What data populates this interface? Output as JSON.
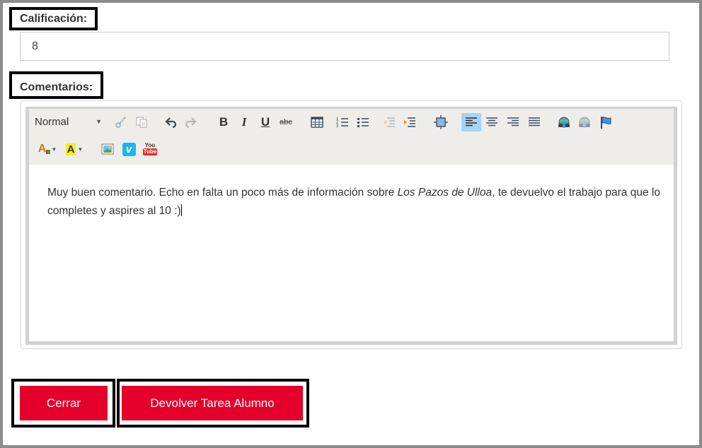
{
  "form": {
    "grade_label": "Calificación:",
    "grade_value": "8",
    "comments_label": "Comentarios:"
  },
  "editor": {
    "format_select": "Normal",
    "toolbar": [
      "cut-icon",
      "copy-icon",
      "undo-icon",
      "redo-icon",
      "bold-icon",
      "italic-icon",
      "underline-icon",
      "strikethrough-icon",
      "table-icon",
      "numbered-list-icon",
      "bulleted-list-icon",
      "outdent-icon",
      "indent-icon",
      "embed-icon",
      "align-left-icon",
      "align-center-icon",
      "align-right-icon",
      "justify-icon",
      "link-icon",
      "unlink-icon",
      "anchor-icon",
      "text-color-icon",
      "background-color-icon",
      "image-icon",
      "vimeo-icon",
      "youtube-icon"
    ],
    "icons": {
      "bold": "B",
      "italic": "I",
      "underline": "U",
      "strike": "abc",
      "font_color": "A",
      "bg_color": "A",
      "vimeo": "v",
      "youtube_top": "You",
      "youtube_bottom": "Tube"
    },
    "content": {
      "text_before": "Muy buen comentario. Echo en falta un poco más de información sobre ",
      "text_italic": "Los Pazos de Ulloa",
      "text_after": ", te devuelvo el trabajo para que lo completes y aspires al 10 :)"
    }
  },
  "buttons": {
    "close": "Cerrar",
    "return": "Devolver Tarea Alumno"
  },
  "colors": {
    "accent": "#e4002b",
    "toolbar_bg": "#efedea",
    "active_button": "#a7d2f5"
  }
}
